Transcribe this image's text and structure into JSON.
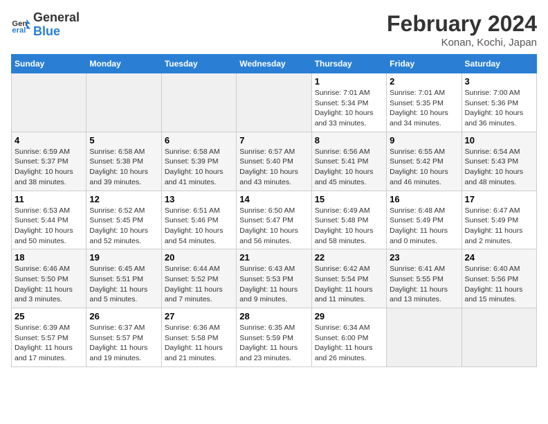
{
  "header": {
    "logo_line1": "General",
    "logo_line2": "Blue",
    "title": "February 2024",
    "subtitle": "Konan, Kochi, Japan"
  },
  "days_of_week": [
    "Sunday",
    "Monday",
    "Tuesday",
    "Wednesday",
    "Thursday",
    "Friday",
    "Saturday"
  ],
  "weeks": [
    [
      {
        "day": "",
        "info": ""
      },
      {
        "day": "",
        "info": ""
      },
      {
        "day": "",
        "info": ""
      },
      {
        "day": "",
        "info": ""
      },
      {
        "day": "1",
        "info": "Sunrise: 7:01 AM\nSunset: 5:34 PM\nDaylight: 10 hours\nand 33 minutes."
      },
      {
        "day": "2",
        "info": "Sunrise: 7:01 AM\nSunset: 5:35 PM\nDaylight: 10 hours\nand 34 minutes."
      },
      {
        "day": "3",
        "info": "Sunrise: 7:00 AM\nSunset: 5:36 PM\nDaylight: 10 hours\nand 36 minutes."
      }
    ],
    [
      {
        "day": "4",
        "info": "Sunrise: 6:59 AM\nSunset: 5:37 PM\nDaylight: 10 hours\nand 38 minutes."
      },
      {
        "day": "5",
        "info": "Sunrise: 6:58 AM\nSunset: 5:38 PM\nDaylight: 10 hours\nand 39 minutes."
      },
      {
        "day": "6",
        "info": "Sunrise: 6:58 AM\nSunset: 5:39 PM\nDaylight: 10 hours\nand 41 minutes."
      },
      {
        "day": "7",
        "info": "Sunrise: 6:57 AM\nSunset: 5:40 PM\nDaylight: 10 hours\nand 43 minutes."
      },
      {
        "day": "8",
        "info": "Sunrise: 6:56 AM\nSunset: 5:41 PM\nDaylight: 10 hours\nand 45 minutes."
      },
      {
        "day": "9",
        "info": "Sunrise: 6:55 AM\nSunset: 5:42 PM\nDaylight: 10 hours\nand 46 minutes."
      },
      {
        "day": "10",
        "info": "Sunrise: 6:54 AM\nSunset: 5:43 PM\nDaylight: 10 hours\nand 48 minutes."
      }
    ],
    [
      {
        "day": "11",
        "info": "Sunrise: 6:53 AM\nSunset: 5:44 PM\nDaylight: 10 hours\nand 50 minutes."
      },
      {
        "day": "12",
        "info": "Sunrise: 6:52 AM\nSunset: 5:45 PM\nDaylight: 10 hours\nand 52 minutes."
      },
      {
        "day": "13",
        "info": "Sunrise: 6:51 AM\nSunset: 5:46 PM\nDaylight: 10 hours\nand 54 minutes."
      },
      {
        "day": "14",
        "info": "Sunrise: 6:50 AM\nSunset: 5:47 PM\nDaylight: 10 hours\nand 56 minutes."
      },
      {
        "day": "15",
        "info": "Sunrise: 6:49 AM\nSunset: 5:48 PM\nDaylight: 10 hours\nand 58 minutes."
      },
      {
        "day": "16",
        "info": "Sunrise: 6:48 AM\nSunset: 5:49 PM\nDaylight: 11 hours\nand 0 minutes."
      },
      {
        "day": "17",
        "info": "Sunrise: 6:47 AM\nSunset: 5:49 PM\nDaylight: 11 hours\nand 2 minutes."
      }
    ],
    [
      {
        "day": "18",
        "info": "Sunrise: 6:46 AM\nSunset: 5:50 PM\nDaylight: 11 hours\nand 3 minutes."
      },
      {
        "day": "19",
        "info": "Sunrise: 6:45 AM\nSunset: 5:51 PM\nDaylight: 11 hours\nand 5 minutes."
      },
      {
        "day": "20",
        "info": "Sunrise: 6:44 AM\nSunset: 5:52 PM\nDaylight: 11 hours\nand 7 minutes."
      },
      {
        "day": "21",
        "info": "Sunrise: 6:43 AM\nSunset: 5:53 PM\nDaylight: 11 hours\nand 9 minutes."
      },
      {
        "day": "22",
        "info": "Sunrise: 6:42 AM\nSunset: 5:54 PM\nDaylight: 11 hours\nand 11 minutes."
      },
      {
        "day": "23",
        "info": "Sunrise: 6:41 AM\nSunset: 5:55 PM\nDaylight: 11 hours\nand 13 minutes."
      },
      {
        "day": "24",
        "info": "Sunrise: 6:40 AM\nSunset: 5:56 PM\nDaylight: 11 hours\nand 15 minutes."
      }
    ],
    [
      {
        "day": "25",
        "info": "Sunrise: 6:39 AM\nSunset: 5:57 PM\nDaylight: 11 hours\nand 17 minutes."
      },
      {
        "day": "26",
        "info": "Sunrise: 6:37 AM\nSunset: 5:57 PM\nDaylight: 11 hours\nand 19 minutes."
      },
      {
        "day": "27",
        "info": "Sunrise: 6:36 AM\nSunset: 5:58 PM\nDaylight: 11 hours\nand 21 minutes."
      },
      {
        "day": "28",
        "info": "Sunrise: 6:35 AM\nSunset: 5:59 PM\nDaylight: 11 hours\nand 23 minutes."
      },
      {
        "day": "29",
        "info": "Sunrise: 6:34 AM\nSunset: 6:00 PM\nDaylight: 11 hours\nand 26 minutes."
      },
      {
        "day": "",
        "info": ""
      },
      {
        "day": "",
        "info": ""
      }
    ]
  ]
}
